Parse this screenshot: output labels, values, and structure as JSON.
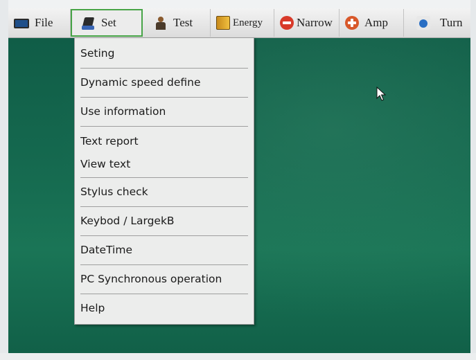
{
  "menubar": {
    "items": [
      {
        "label": "File",
        "icon": "monitor-icon"
      },
      {
        "label": "Set",
        "icon": "settings-icon",
        "active": true
      },
      {
        "label": "Test",
        "icon": "person-icon"
      },
      {
        "label": "Energy",
        "icon": "book-icon"
      },
      {
        "label": "Narrow",
        "icon": "minus-circle-icon"
      },
      {
        "label": "Amp",
        "icon": "plus-circle-icon"
      },
      {
        "label": "Turn",
        "icon": "turn-icon"
      }
    ]
  },
  "set_menu": {
    "groups": [
      [
        "Seting"
      ],
      [
        "Dynamic speed define"
      ],
      [
        "Use information"
      ],
      [
        "Text report",
        "View text"
      ],
      [
        "Stylus check"
      ],
      [
        "Keybod / LargekB"
      ],
      [
        "DateTime"
      ],
      [
        "PC Synchronous operation"
      ],
      [
        "Help"
      ]
    ]
  },
  "colors": {
    "desktop": "#15694f",
    "menubar": "#e6e6e6",
    "active_border": "#47a447",
    "dropdown_bg": "#ecedec"
  }
}
